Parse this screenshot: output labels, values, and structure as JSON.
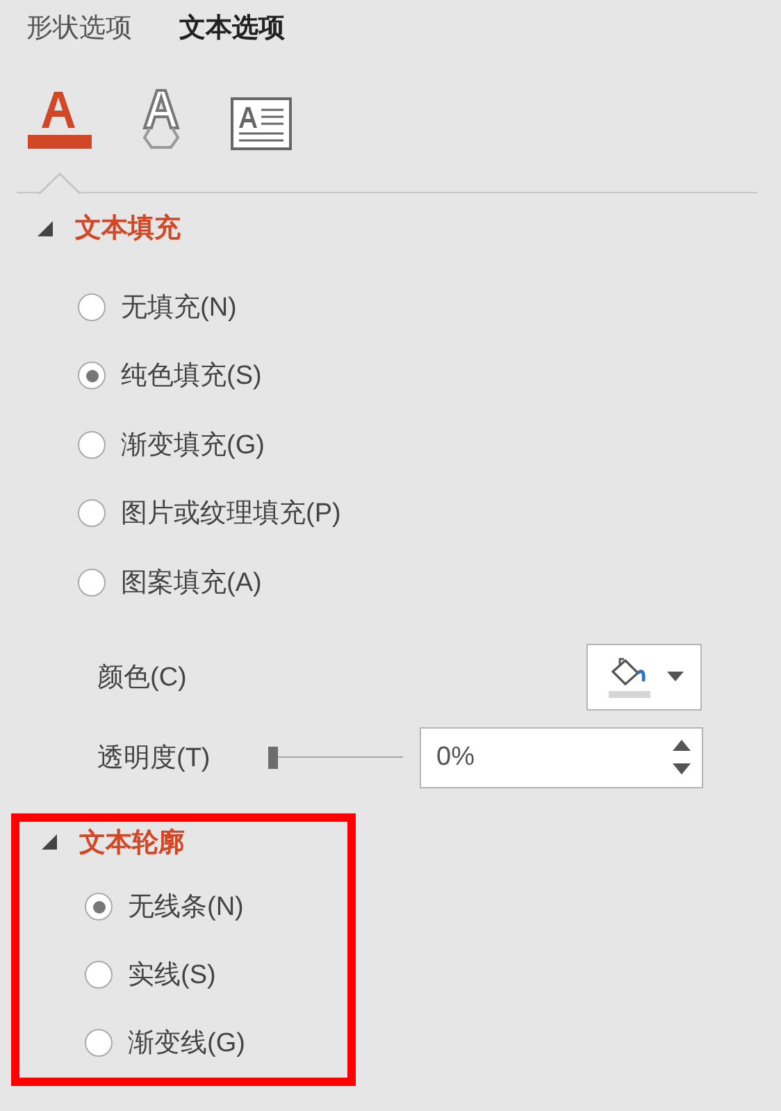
{
  "tabs": [
    {
      "label": "形状选项",
      "selected": false
    },
    {
      "label": "文本选项",
      "selected": true
    }
  ],
  "icon_tabs": [
    {
      "kind": "fill",
      "selected": true
    },
    {
      "kind": "outline",
      "selected": false
    },
    {
      "kind": "textbox",
      "selected": false
    }
  ],
  "sections": [
    {
      "title": "文本填充",
      "expanded": true,
      "highlighted": false,
      "options": [
        {
          "label": "无填充(N)",
          "selected": false
        },
        {
          "label": "纯色填充(S)",
          "selected": true
        },
        {
          "label": "渐变填充(G)",
          "selected": false
        },
        {
          "label": "图片或纹理填充(P)",
          "selected": false
        },
        {
          "label": "图案填充(A)",
          "selected": false
        }
      ],
      "color": {
        "label": "颜色(C)"
      },
      "transparency": {
        "label": "透明度(T)",
        "level": 0,
        "value": "0%"
      }
    },
    {
      "title": "文本轮廓",
      "expanded": true,
      "highlighted": true,
      "options": [
        {
          "label": "无线条(N)",
          "selected": true
        },
        {
          "label": "实线(S)",
          "selected": false
        },
        {
          "label": "渐变线(G)",
          "selected": false
        }
      ]
    }
  ]
}
